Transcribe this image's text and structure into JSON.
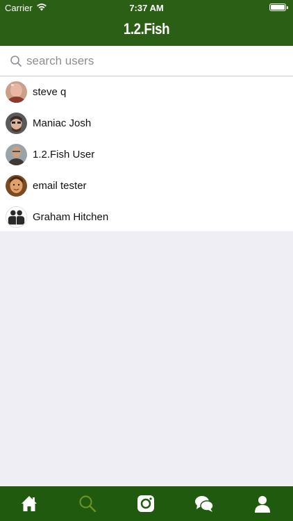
{
  "status_bar": {
    "carrier": "Carrier",
    "time": "7:37 AM",
    "battery_level": 1.0
  },
  "header": {
    "title": "1.2.Fish"
  },
  "search": {
    "placeholder": "search users",
    "value": "",
    "icon": "search-icon"
  },
  "users": [
    {
      "name": "steve q"
    },
    {
      "name": "Maniac Josh"
    },
    {
      "name": "1.2.Fish User"
    },
    {
      "name": "email tester"
    },
    {
      "name": "Graham Hitchen"
    }
  ],
  "tabs": [
    {
      "icon": "home-icon",
      "active": false
    },
    {
      "icon": "search-icon",
      "active": true
    },
    {
      "icon": "camera-icon",
      "active": false
    },
    {
      "icon": "chat-icon",
      "active": false
    },
    {
      "icon": "profile-icon",
      "active": false
    }
  ],
  "colors": {
    "brand_green": "#2c5f16",
    "tabbar_green": "#1f5a0f",
    "active_tab": "#6b8f2a"
  }
}
